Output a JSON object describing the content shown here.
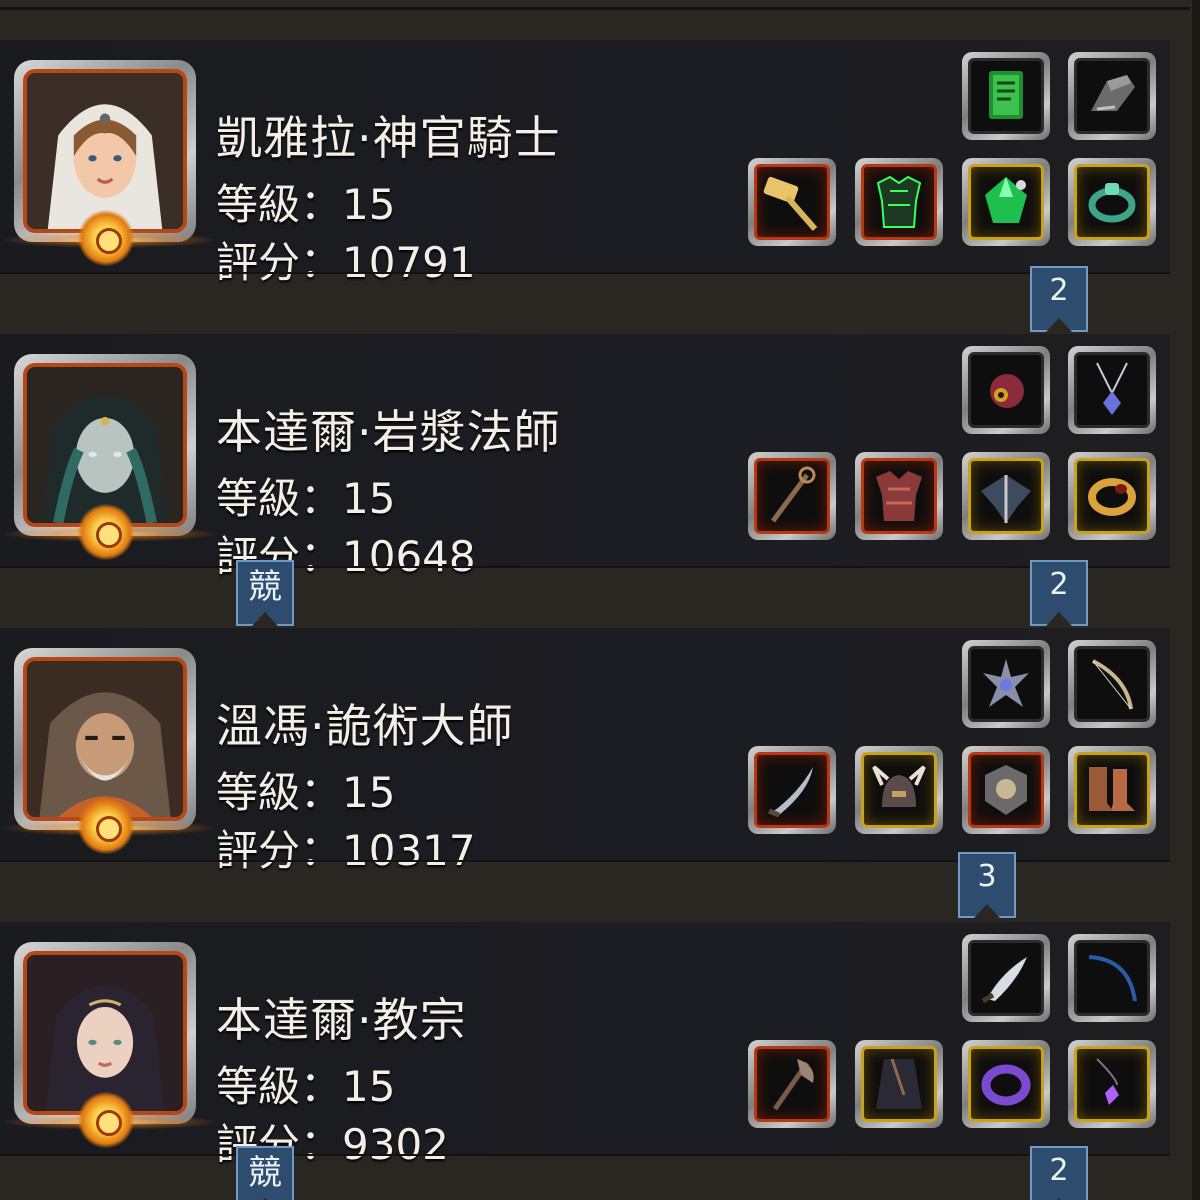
{
  "characters": [
    {
      "name": "凱雅拉·神官騎士",
      "level_text": "等級：15",
      "score_text": "評分：10791",
      "portrait": "female-priest-knight-portrait",
      "items_top": [
        {
          "icon": "green-spellbook-icon",
          "rarity": "none"
        },
        {
          "icon": "gauntlet-icon",
          "rarity": "none"
        }
      ],
      "items_bottom": [
        {
          "icon": "golden-hammer-icon",
          "rarity": "legendary"
        },
        {
          "icon": "green-armor-icon",
          "rarity": "legendary"
        },
        {
          "icon": "emerald-gem-icon",
          "rarity": "epic"
        },
        {
          "icon": "jade-ring-icon",
          "rarity": "epic"
        }
      ],
      "badges": [
        {
          "label": "2"
        }
      ]
    },
    {
      "name": "本達爾·岩漿法師",
      "level_text": "等級：15",
      "score_text": "評分：10648",
      "portrait": "hooded-mage-portrait",
      "items_top": [
        {
          "icon": "red-orb-icon",
          "rarity": "none"
        },
        {
          "icon": "blue-amulet-icon",
          "rarity": "none"
        }
      ],
      "items_bottom": [
        {
          "icon": "staff-icon",
          "rarity": "legendary"
        },
        {
          "icon": "red-plate-armor-icon",
          "rarity": "legendary"
        },
        {
          "icon": "pauldron-icon",
          "rarity": "epic"
        },
        {
          "icon": "gold-ring-icon",
          "rarity": "epic"
        }
      ],
      "badges": [
        {
          "label": "競"
        },
        {
          "label": "2"
        }
      ]
    },
    {
      "name": "溫馮·詭術大師",
      "level_text": "等級：15",
      "score_text": "評分：10317",
      "portrait": "bearded-hooded-rogue-portrait",
      "items_top": [
        {
          "icon": "star-emblem-icon",
          "rarity": "none"
        },
        {
          "icon": "bow-icon",
          "rarity": "none"
        }
      ],
      "items_bottom": [
        {
          "icon": "curved-dagger-icon",
          "rarity": "legendary"
        },
        {
          "icon": "horned-helmet-icon",
          "rarity": "epic"
        },
        {
          "icon": "shield-talisman-icon",
          "rarity": "legendary"
        },
        {
          "icon": "leather-boots-icon",
          "rarity": "epic"
        }
      ],
      "badges": [
        {
          "label": "3"
        }
      ]
    },
    {
      "name": "本達爾·教宗",
      "level_text": "等級：15",
      "score_text": "評分：9302",
      "portrait": "hooded-pope-portrait",
      "items_top": [
        {
          "icon": "knife-icon",
          "rarity": "none"
        },
        {
          "icon": "blue-whip-icon",
          "rarity": "none"
        }
      ],
      "items_bottom": [
        {
          "icon": "war-axe-icon",
          "rarity": "legendary"
        },
        {
          "icon": "dark-cloak-icon",
          "rarity": "epic"
        },
        {
          "icon": "purple-bracelet-icon",
          "rarity": "epic"
        },
        {
          "icon": "violet-pendant-icon",
          "rarity": "epic"
        }
      ],
      "badges": [
        {
          "label": "競"
        },
        {
          "label": "2"
        }
      ]
    }
  ],
  "colors": {
    "legendary": "#b53a12",
    "epic": "#c9a21b",
    "badge": "#2e4d6e"
  }
}
